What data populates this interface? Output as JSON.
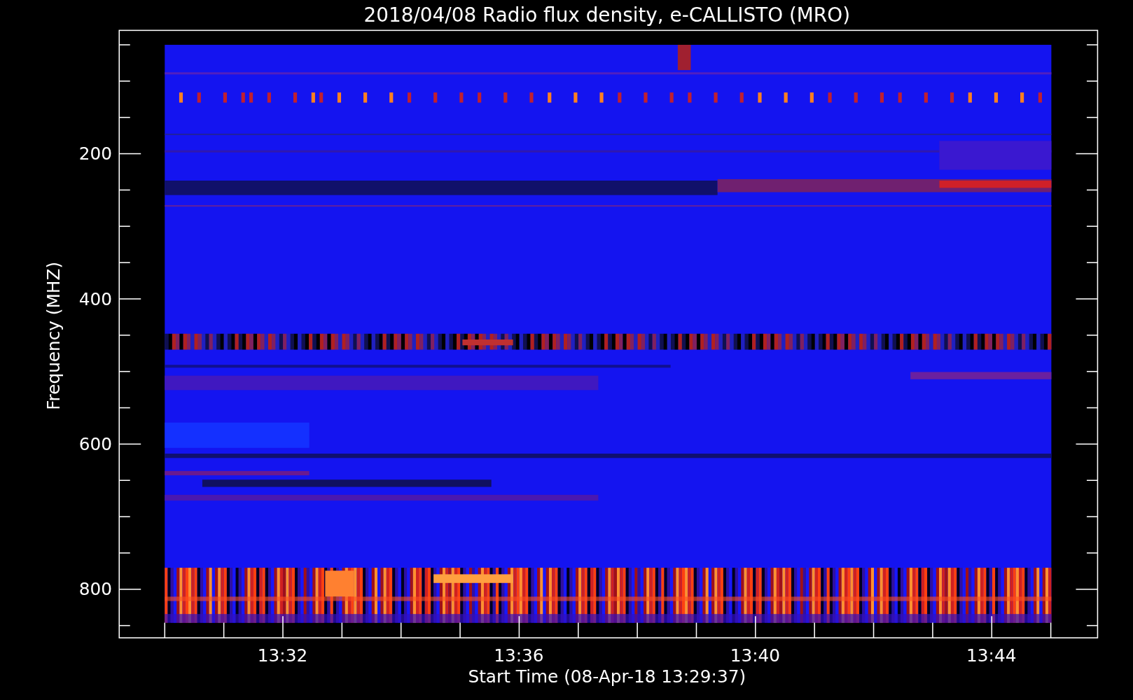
{
  "title": "2018/04/08  Radio flux density, e-CALLISTO (MRO)",
  "y_axis": {
    "label": "Frequency (MHZ)",
    "tick_labels": [
      "200",
      "400",
      "600",
      "800"
    ]
  },
  "x_axis": {
    "label": "Start Time (08-Apr-18 13:29:37)",
    "tick_labels": [
      "13:32",
      "13:36",
      "13:40",
      "13:44"
    ]
  }
}
